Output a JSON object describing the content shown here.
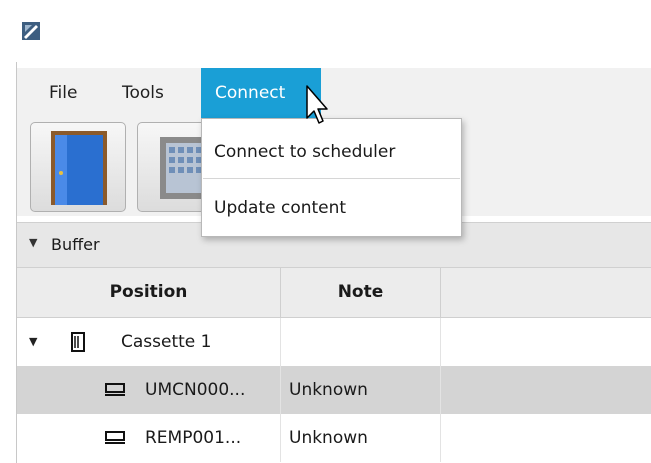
{
  "app": {
    "icon": "app-logo-icon"
  },
  "menubar": {
    "items": [
      "File",
      "Tools",
      "Connect"
    ],
    "active": "Connect"
  },
  "toolbar": {
    "buttons": [
      {
        "icon": "door-icon"
      },
      {
        "icon": "building-icon"
      }
    ]
  },
  "connect_menu": {
    "items": [
      "Connect to scheduler",
      "Update content"
    ]
  },
  "buffer_panel": {
    "title": "Buffer"
  },
  "table": {
    "columns": [
      "Position",
      "Note"
    ],
    "rows": [
      {
        "position": "Cassette 1",
        "note": "",
        "icon": "cassette-icon",
        "expanded": true
      },
      {
        "position": "UMCN000...",
        "note": "Unknown",
        "icon": "slot-icon",
        "selected": true
      },
      {
        "position": "REMP001...",
        "note": "Unknown",
        "icon": "slot-icon"
      }
    ]
  },
  "colors": {
    "accent": "#1a9fd6",
    "menubar": "#f1f1f1",
    "selected_row": "#d4d4d4"
  }
}
